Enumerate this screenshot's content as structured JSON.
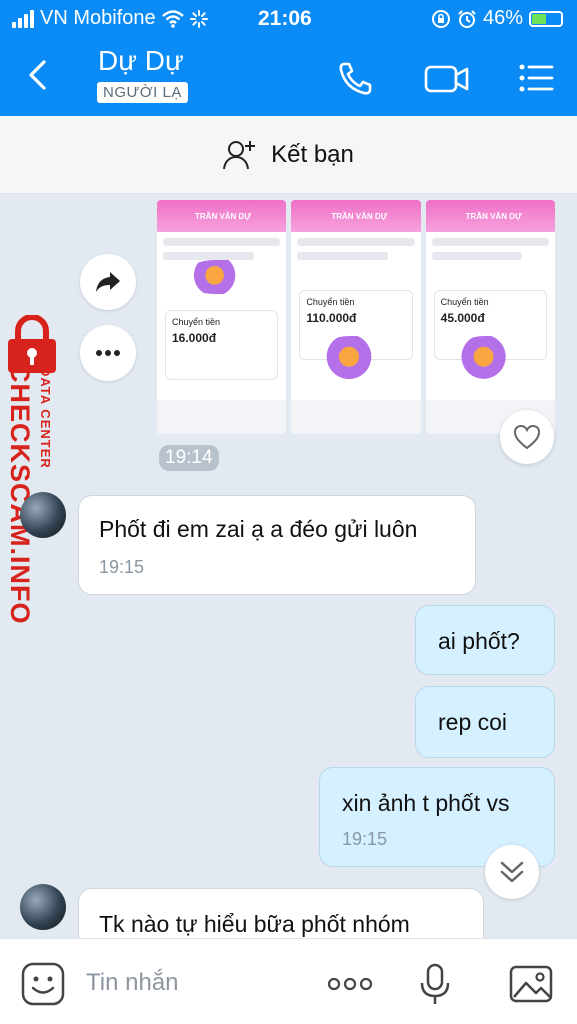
{
  "status_bar": {
    "carrier": "VN Mobifone",
    "time": "21:06",
    "battery": "46%"
  },
  "header": {
    "contact_name": "Dự Dự",
    "contact_tag": "NGƯỜI LẠ"
  },
  "friend_bar": {
    "label": "Kết bạn"
  },
  "image_message": {
    "time": "19:14",
    "thumbnails": [
      {
        "name": "TRẦN VĂN DỰ",
        "title": "Chuyển tiền",
        "amount": "16.000đ"
      },
      {
        "name": "TRẦN VĂN DỰ",
        "title": "Chuyển tiền",
        "amount": "110.000đ"
      },
      {
        "name": "TRẦN VĂN DỰ",
        "title": "Chuyển tiền",
        "amount": "45.000đ"
      }
    ]
  },
  "watermark": {
    "brand": "CHECKSCAM.INFO",
    "subtitle": "DATA CENTER"
  },
  "messages": [
    {
      "direction": "in",
      "text": "Phốt đi em zai ạ a đéo gửi luôn",
      "time": "19:15"
    },
    {
      "direction": "out",
      "text": "ai phốt?"
    },
    {
      "direction": "out",
      "text": "rep coi"
    },
    {
      "direction": "out",
      "text": "xin ảnh t phốt vs",
      "time": "19:15"
    },
    {
      "direction": "in",
      "text": "Tk nào tự hiểu bữa phốt nhóm"
    }
  ],
  "composer": {
    "placeholder": "Tin nhắn"
  },
  "colors": {
    "header": "#0a8bf5",
    "outgoing_bubble": "#d5f0ff",
    "incoming_bubble": "#ffffff",
    "chat_bg": "#e2e9f1",
    "watermark": "#d8231c"
  }
}
